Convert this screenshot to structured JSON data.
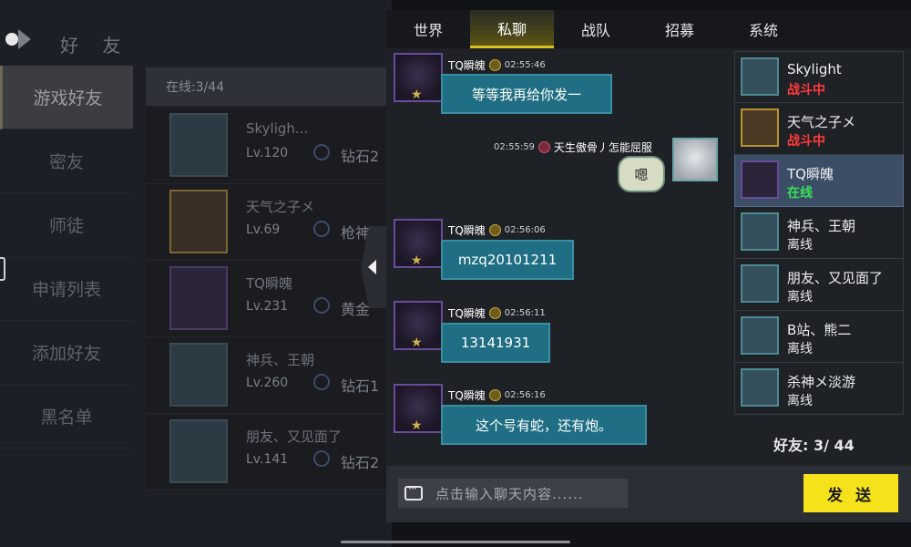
{
  "left": {
    "title": "好 友",
    "menu": [
      "游戏好友",
      "密友",
      "师徒",
      "申请列表",
      "添加好友",
      "黑名单"
    ],
    "online_count": "在线:3/44",
    "list": [
      {
        "name": "Skyligh...",
        "level": "Lv.120",
        "rank": "钻石2"
      },
      {
        "name": "天气之子メ",
        "level": "Lv.69",
        "rank": "枪神"
      },
      {
        "name": "TQ瞬魄",
        "level": "Lv.231",
        "rank": "黄金"
      },
      {
        "name": "神兵、王朝",
        "level": "Lv.260",
        "rank": "钻石1"
      },
      {
        "name": "朋友、又见面了",
        "level": "Lv.141",
        "rank": "钻石2"
      }
    ]
  },
  "chat": {
    "tabs": [
      "世界",
      "私聊",
      "战队",
      "招募",
      "系统"
    ],
    "messages": [
      {
        "sender": "TQ瞬魄",
        "time": "02:55:46",
        "text": "等等我再给你发一"
      },
      {
        "sender": "天生傲骨丿怎能屈服",
        "time": "02:55:59",
        "text": "嗯"
      },
      {
        "sender": "TQ瞬魄",
        "time": "02:56:06",
        "text": "mzq20101211"
      },
      {
        "sender": "TQ瞬魄",
        "time": "02:56:11",
        "text": "13141931"
      },
      {
        "sender": "TQ瞬魄",
        "time": "02:56:16",
        "text": "这个号有蛇，还有炮。"
      }
    ],
    "friends": [
      {
        "name": "Skylight",
        "status": "战斗中"
      },
      {
        "name": "天气之子メ",
        "status": "战斗中"
      },
      {
        "name": "TQ瞬魄",
        "status": "在线"
      },
      {
        "name": "神兵、王朝",
        "status": "离线"
      },
      {
        "name": "朋友、又见面了",
        "status": "离线"
      },
      {
        "name": "B站、熊二",
        "status": "离线"
      },
      {
        "name": "杀神メ淡游",
        "status": "离线"
      }
    ],
    "friend_count": "好友: 3/ 44",
    "input_placeholder": "点击输入聊天内容......",
    "send_label": "发 送"
  },
  "colors": {
    "accent": "#f6e21a",
    "bubble": "#1f6e83",
    "online": "#39e25a",
    "fighting": "#ff3a3a"
  }
}
